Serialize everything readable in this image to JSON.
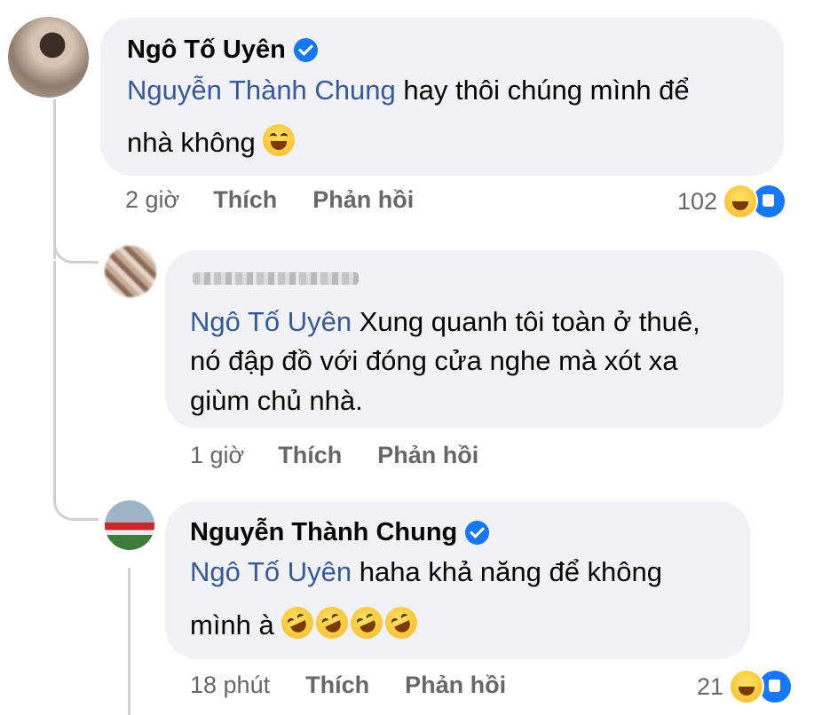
{
  "comments": [
    {
      "author": "Ngô Tố Uyên",
      "mention": "Nguyễn Thành Chung",
      "line1_rest": " hay thôi chúng mình để",
      "line2": "nhà không ",
      "emoji": [
        "grinning-squinting-face"
      ],
      "time": "2 giờ",
      "like_label": "Thích",
      "reply_label": "Phản hồi",
      "reaction_count": "102",
      "reactions": [
        "haha",
        "like"
      ]
    },
    {
      "author": "",
      "author_blurred": true,
      "mention": "Ngô Tố Uyên",
      "line1_rest": " Xung quanh tôi toàn ở thuê,",
      "line2": "nó đập đồ với đóng cửa nghe mà xót xa",
      "line3": "giùm chủ nhà.",
      "time": "1 giờ",
      "like_label": "Thích",
      "reply_label": "Phản hồi"
    },
    {
      "author": "Nguyễn Thành Chung",
      "mention": "Ngô Tố Uyên",
      "line1_rest": "  haha khả năng để không",
      "line2": "mình à ",
      "emoji": [
        "rolling-laughing-face",
        "rolling-laughing-face",
        "rolling-laughing-face",
        "rolling-laughing-face"
      ],
      "time": "18 phút",
      "like_label": "Thích",
      "reply_label": "Phản hồi",
      "reaction_count": "21",
      "reactions": [
        "haha",
        "like"
      ]
    }
  ],
  "colors": {
    "bubble": "#f0f2f5",
    "mention": "#385898",
    "meta": "#65676b",
    "verified": "#1877f2",
    "thread_line": "#ced0d4"
  }
}
